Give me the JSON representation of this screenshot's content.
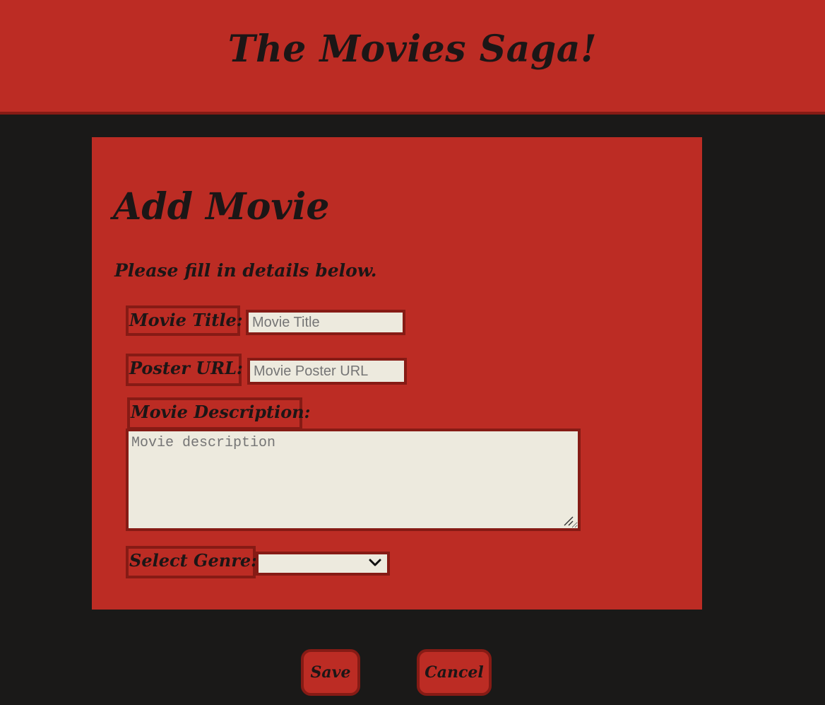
{
  "header": {
    "title": "The Movies Saga!"
  },
  "form": {
    "heading": "Add Movie",
    "intro": "Please fill in details below.",
    "fields": {
      "title": {
        "label": "Movie Title:",
        "placeholder": "Movie Title",
        "value": ""
      },
      "poster": {
        "label": "Poster URL:",
        "placeholder": "Movie Poster URL",
        "value": ""
      },
      "description": {
        "label": "Movie Description:",
        "placeholder": "Movie description",
        "value": ""
      },
      "genre": {
        "label": "Select Genre:",
        "selected": ""
      }
    }
  },
  "actions": {
    "save_label": "Save",
    "cancel_label": "Cancel"
  },
  "icons": {
    "select_arrow": "chevron-down-icon",
    "resize_handle": "resize-grip-icon"
  },
  "colors": {
    "background": "#1a1918",
    "accent_red": "#bc2c24",
    "border_red": "#861b15",
    "field_fill": "#edeade",
    "text_dark": "#1c1616",
    "placeholder_gray": "#757575"
  }
}
